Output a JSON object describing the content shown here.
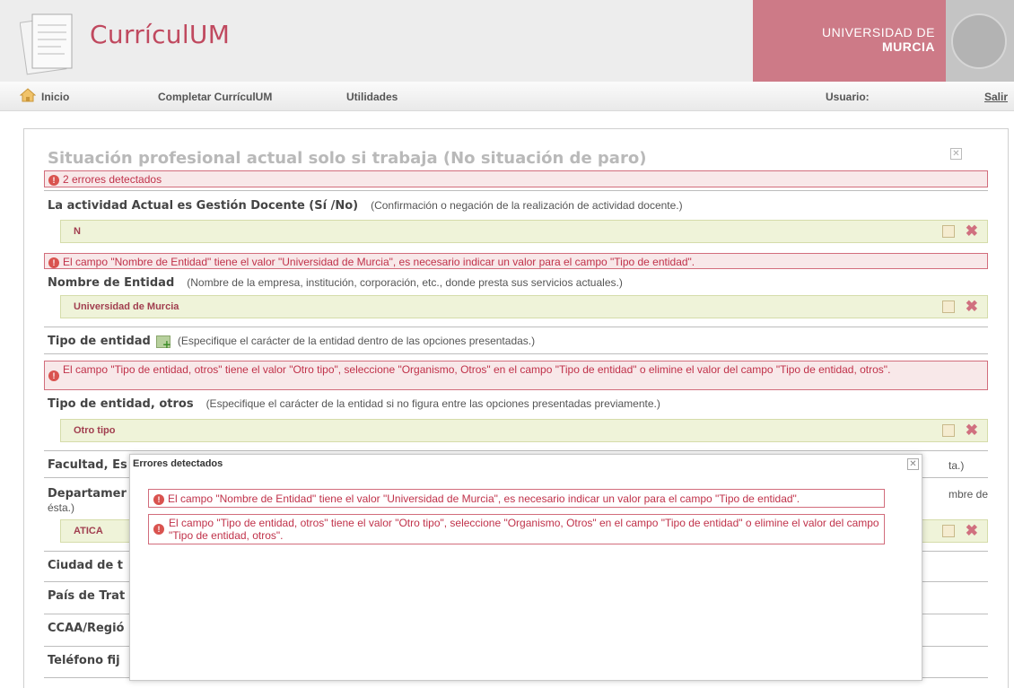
{
  "header": {
    "app_title": "CurrículUM",
    "university_line1": "UNIVERSIDAD DE",
    "university_line2": "MURCIA"
  },
  "nav": {
    "home": "Inicio",
    "complete": "Completar CurrículUM",
    "utilities": "Utilidades",
    "user_label": "Usuario:",
    "logout": "Salir"
  },
  "panel": {
    "title": "Situación profesional actual solo si trabaja (No situación de paro)",
    "error_summary": "2 errores detectados",
    "fields": [
      {
        "label": "La actividad Actual es Gestión Docente (Sí /No)",
        "help": "(Confirmación o negación de la realización de actividad docente.)",
        "value": "N"
      },
      {
        "error": "El campo \"Nombre de Entidad\" tiene el valor \"Universidad de Murcia\", es necesario indicar un valor para el campo \"Tipo de entidad\".",
        "label": "Nombre de Entidad",
        "help": "(Nombre de la empresa, institución, corporación, etc., donde presta sus servicios actuales.)",
        "value": "Universidad de Murcia"
      },
      {
        "label": "Tipo de entidad",
        "help": "(Especifique el carácter de la entidad dentro de las opciones presentadas.)"
      },
      {
        "error": "El campo \"Tipo de entidad, otros\" tiene el valor \"Otro tipo\", seleccione \"Organismo, Otros\" en el campo \"Tipo de entidad\" o elimine el valor del campo \"Tipo de entidad, otros\".",
        "label": "Tipo de entidad, otros",
        "help": "(Especifique el carácter de la entidad si no figura entre las opciones presentadas previamente.)",
        "value": "Otro tipo"
      },
      {
        "label": "Facultad, Es",
        "help_tail": "ta.)"
      },
      {
        "label": "Departamer",
        "help_tail": "mbre de",
        "help_wrap": "ésta.)",
        "value": "ATICA"
      },
      {
        "label": "Ciudad de t"
      },
      {
        "label": "País de Trat"
      },
      {
        "label": "CCAA/Regió"
      },
      {
        "label": "Teléfono fij"
      }
    ]
  },
  "modal": {
    "title": "Errores detectados",
    "errors": [
      "El campo \"Nombre de Entidad\" tiene el valor \"Universidad de Murcia\", es necesario indicar un valor para el campo \"Tipo de entidad\".",
      "El campo \"Tipo de entidad, otros\" tiene el valor \"Otro tipo\", seleccione \"Organismo, Otros\" en el campo \"Tipo de entidad\" o elimine el valor del campo \"Tipo de entidad, otros\"."
    ]
  },
  "colors": {
    "brand": "#c0495f",
    "university_block": "#cd7a87",
    "error_text": "#c0324a",
    "value_bg": "#eff3d9"
  }
}
